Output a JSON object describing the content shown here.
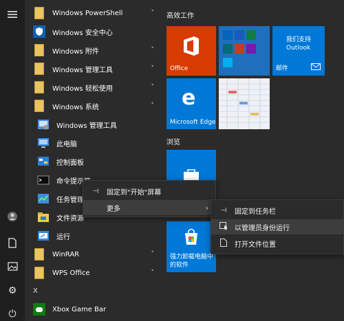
{
  "rail": {
    "icons": [
      "hamburger-icon",
      "user-icon",
      "document-icon",
      "pictures-icon",
      "settings-icon",
      "power-icon"
    ]
  },
  "app_list": {
    "items": [
      {
        "label": "Windows PowerShell",
        "icon": "folder-icon",
        "expand": "˅"
      },
      {
        "label": "Windows 安全中心",
        "icon": "shield-icon"
      },
      {
        "label": "Windows 附件",
        "icon": "folder-icon",
        "expand": "˅"
      },
      {
        "label": "Windows 管理工具",
        "icon": "folder-icon",
        "expand": "˅"
      },
      {
        "label": "Windows 轻松使用",
        "icon": "folder-icon",
        "expand": "˅"
      },
      {
        "label": "Windows 系统",
        "icon": "folder-icon",
        "expand": "˄"
      },
      {
        "label": "Windows 管理工具",
        "icon": "admin-tools-icon"
      },
      {
        "label": "此电脑",
        "icon": "this-pc-icon"
      },
      {
        "label": "控制面板",
        "icon": "control-panel-icon"
      },
      {
        "label": "命令提示符",
        "icon": "cmd-icon"
      },
      {
        "label": "任务管理",
        "icon": "task-manager-icon"
      },
      {
        "label": "文件资源",
        "icon": "file-explorer-icon"
      },
      {
        "label": "运行",
        "icon": "run-icon"
      },
      {
        "label": "WinRAR",
        "icon": "folder-icon",
        "expand": "˅"
      },
      {
        "label": "WPS Office",
        "icon": "folder-icon",
        "expand": "˅"
      }
    ],
    "letter_x": "X",
    "xbox": {
      "label": "Xbox Game Bar",
      "icon": "xbox-icon"
    }
  },
  "tiles": {
    "group1_title": "高效工作",
    "group2_title": "浏览",
    "office": {
      "label": "Office",
      "color": "#d83b01"
    },
    "mail": {
      "label": "邮件",
      "text": "我们支持 Outlook",
      "color": "#0078d7"
    },
    "edge": {
      "label": "Microsoft Edge",
      "color": "#0078d7"
    },
    "store": {
      "label": "强力卸载电脑中的软件",
      "color": "#0078d7"
    }
  },
  "context_menu": {
    "items": [
      {
        "label": "固定到\"开始\"屏幕",
        "icon": "pin-icon"
      },
      {
        "label": "更多",
        "arrow": "›"
      }
    ]
  },
  "submenu": {
    "items": [
      {
        "label": "固定到任务栏",
        "icon": "pin-icon"
      },
      {
        "label": "以管理员身份运行",
        "icon": "shield-run-icon"
      },
      {
        "label": "打开文件位置",
        "icon": "file-location-icon"
      }
    ]
  },
  "colors": {
    "accent": "#0078d7",
    "folder": "#e9c462",
    "background": "#2b2b2b",
    "rail": "#1f1f1f"
  }
}
